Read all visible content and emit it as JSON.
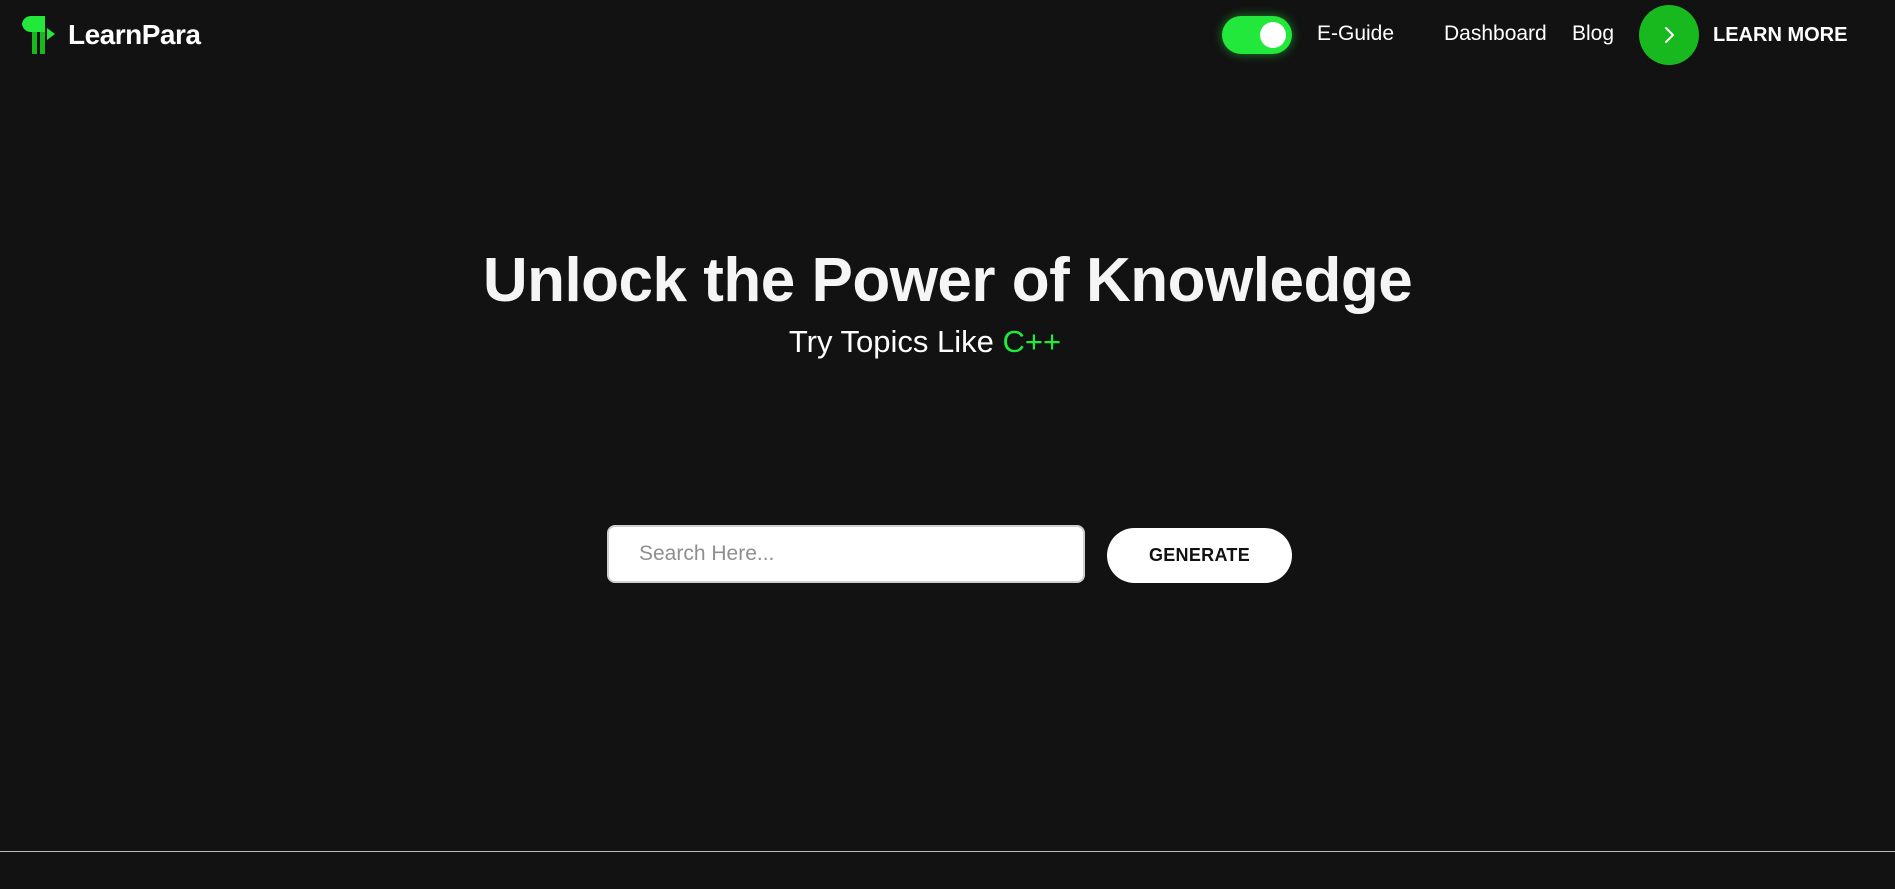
{
  "brand": {
    "name": "LearnPara",
    "accent_color": "#22e83c",
    "logo_icon": "pilcrow-logo-icon"
  },
  "nav": {
    "toggle_state": "on",
    "links": [
      {
        "label": "E-Guide"
      },
      {
        "label": "Dashboard"
      },
      {
        "label": "Blog"
      }
    ],
    "cta": {
      "label": "LEARN MORE",
      "icon": "chevron-right-icon"
    }
  },
  "hero": {
    "title": "Unlock the Power of Knowledge",
    "subtitle_prefix": "Try Topics Like ",
    "subtitle_topic": "C++"
  },
  "search": {
    "placeholder": "Search Here...",
    "value": "",
    "button_label": "GENERATE"
  },
  "colors": {
    "background": "#121212",
    "accent": "#22e83c",
    "text": "#ffffff"
  }
}
